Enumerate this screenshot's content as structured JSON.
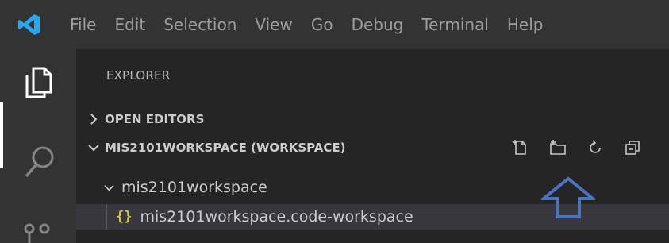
{
  "menubar": {
    "logo_icon": "vscode-logo-icon",
    "items": [
      "File",
      "Edit",
      "Selection",
      "View",
      "Go",
      "Debug",
      "Terminal",
      "Help"
    ]
  },
  "activitybar": {
    "items": [
      {
        "icon": "files-icon",
        "active": true
      },
      {
        "icon": "search-icon",
        "active": false
      },
      {
        "icon": "source-control-icon",
        "active": false
      }
    ]
  },
  "explorer": {
    "title": "EXPLORER",
    "sections": {
      "open_editors": {
        "label": "OPEN EDITORS",
        "expanded": false
      },
      "workspace": {
        "label": "MIS2101WORKSPACE (WORKSPACE)",
        "expanded": true,
        "actions": [
          "new-file-icon",
          "new-folder-icon",
          "refresh-icon",
          "collapse-all-icon"
        ]
      }
    },
    "tree": {
      "folder": {
        "label": "mis2101workspace",
        "expanded": true
      },
      "file": {
        "label": "mis2101workspace.code-workspace",
        "icon": "{}"
      }
    }
  },
  "annotation": {
    "icon": "up-arrow-icon",
    "color": "#4a74c0"
  },
  "colors": {
    "background": "#252526",
    "bars": "#333333",
    "text": "#cccccc",
    "json_icon": "#cbcb41",
    "vscode_blue": "#23a9f2"
  }
}
